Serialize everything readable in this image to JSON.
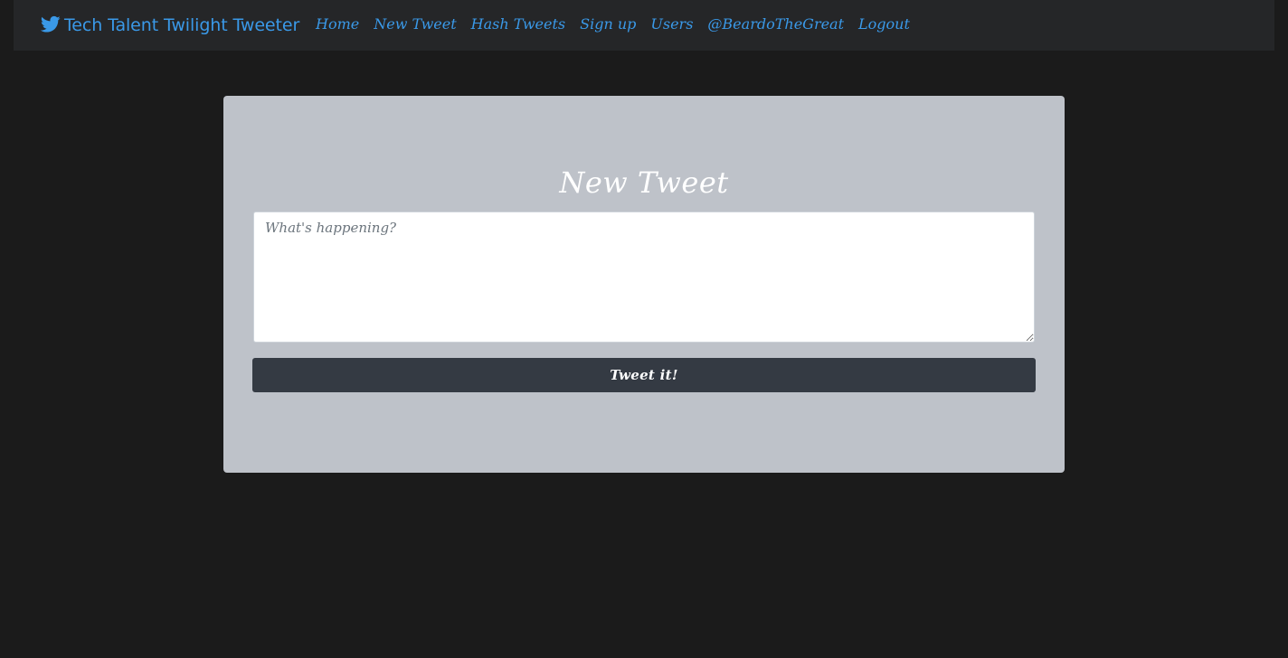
{
  "theme": {
    "page_background": "#1b1b1b",
    "navbar_background": "#252628",
    "link_color": "#3a99e8",
    "card_background": "#bec2c9",
    "button_background": "#343a43"
  },
  "navbar": {
    "brand": {
      "icon": "twitter-bird-icon",
      "label": "Tech Talent Twilight Tweeter"
    },
    "links": [
      {
        "label": "Home"
      },
      {
        "label": "New Tweet"
      },
      {
        "label": "Hash Tweets"
      },
      {
        "label": "Sign up"
      },
      {
        "label": "Users"
      },
      {
        "label": "@BeardoTheGreat"
      },
      {
        "label": "Logout"
      }
    ]
  },
  "form": {
    "title": "New Tweet",
    "input": {
      "placeholder": "What's happening?",
      "value": ""
    },
    "submit_label": "Tweet it!"
  }
}
